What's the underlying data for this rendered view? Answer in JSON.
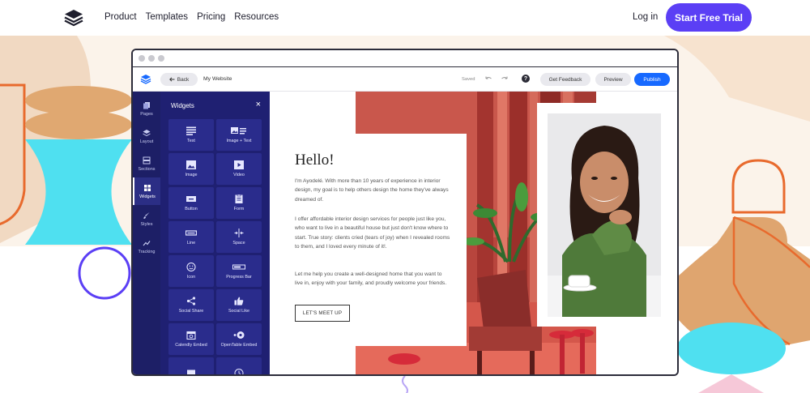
{
  "nav": {
    "links": [
      "Product",
      "Templates",
      "Pricing",
      "Resources"
    ],
    "login": "Log in",
    "cta": "Start Free Trial"
  },
  "editor": {
    "back": "Back",
    "site_name": "My Website",
    "saved": "Saved",
    "help": "?",
    "feedback": "Get Feedback",
    "preview": "Preview",
    "publish": "Publish"
  },
  "rail": {
    "items": [
      {
        "label": "Pages",
        "icon": "pages-icon"
      },
      {
        "label": "Layout",
        "icon": "layers-icon"
      },
      {
        "label": "Sections",
        "icon": "sections-icon"
      },
      {
        "label": "Widgets",
        "icon": "widgets-icon"
      },
      {
        "label": "Styles",
        "icon": "brush-icon"
      },
      {
        "label": "Tracking",
        "icon": "chart-icon"
      }
    ],
    "active": "Widgets"
  },
  "widgets_panel": {
    "title": "Widgets",
    "close": "×",
    "tiles": [
      {
        "label": "Text",
        "icon": "text-icon"
      },
      {
        "label": "Image + Text",
        "icon": "image-text-icon"
      },
      {
        "label": "Image",
        "icon": "image-icon"
      },
      {
        "label": "Video",
        "icon": "video-icon"
      },
      {
        "label": "Button",
        "icon": "button-icon"
      },
      {
        "label": "Form",
        "icon": "form-icon"
      },
      {
        "label": "Line",
        "icon": "line-icon"
      },
      {
        "label": "Space",
        "icon": "space-icon"
      },
      {
        "label": "Icon",
        "icon": "smiley-icon"
      },
      {
        "label": "Progress Bar",
        "icon": "progress-bar-icon"
      },
      {
        "label": "Social Share",
        "icon": "share-icon"
      },
      {
        "label": "Social Like",
        "icon": "thumbs-up-icon"
      },
      {
        "label": "Calendly Embed",
        "icon": "calendar-icon"
      },
      {
        "label": "OpenTable Embed",
        "icon": "opentable-icon"
      }
    ]
  },
  "canvas": {
    "title": "Hello!",
    "paragraphs": [
      "I'm Ayodelé. With more than 10 years of experience in interior design, my goal is to help others design the home they've always dreamed of.",
      "I offer affordable interior design services for people just like you, who want to live in a beautiful house but just don't know where to start. True story: clients cried (tears of joy) when I revealed rooms to them, and I loved every minute of it!.",
      "Let me help you create a well-designed home that you want to live in, enjoy with your family, and proudly welcome your friends."
    ],
    "cta": "LET'S MEET UP"
  },
  "colors": {
    "brand": "#5b3ff5",
    "publish": "#1769ff",
    "panel": "#1f2072",
    "rail": "#1d1f66"
  }
}
